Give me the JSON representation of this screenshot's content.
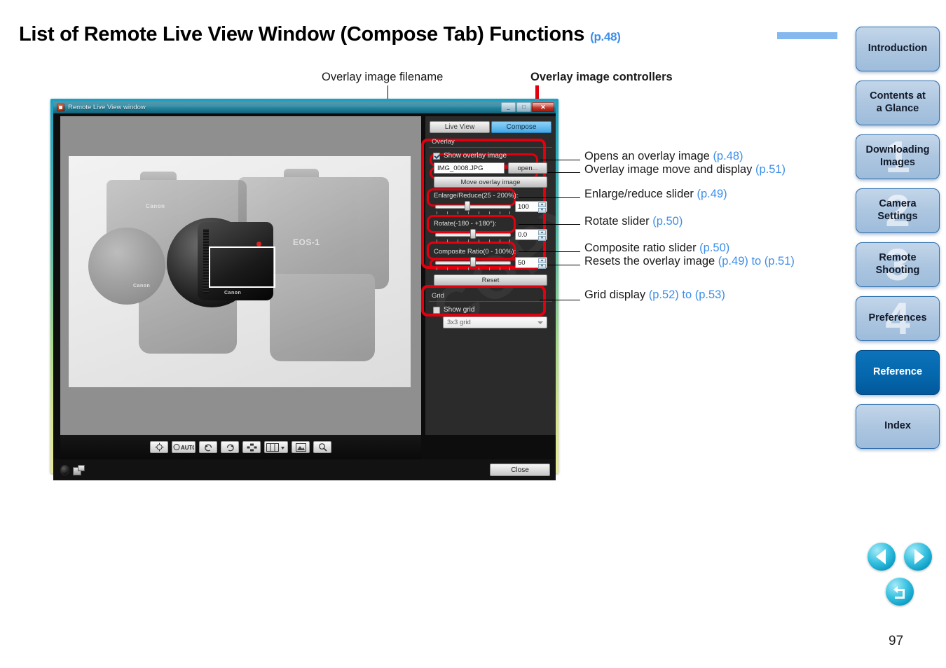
{
  "header": {
    "title": "List of Remote Live View Window (Compose Tab) Functions",
    "title_pageref": "(p.48)"
  },
  "top_captions": {
    "filename": "Overlay image filename",
    "controllers": "Overlay image controllers"
  },
  "window": {
    "title": "Remote Live View window",
    "title_icon": "camera-app-icon",
    "controls": {
      "minimize": "_",
      "maximize": "□",
      "close": "✕"
    },
    "tabs": [
      {
        "label": "Live View",
        "active": false
      },
      {
        "label": "Compose",
        "active": true
      }
    ],
    "watermark": "COPY",
    "overlay_group": {
      "title": "Overlay",
      "show_overlay_label": "Show overlay image",
      "show_overlay_checked": true,
      "filename_value": "IMG_0008.JPG",
      "open_button": "open...",
      "move_button": "Move overlay image",
      "sliders": [
        {
          "label": "Enlarge/Reduce(25 - 200%):",
          "value": "100",
          "thumb_pct": 42
        },
        {
          "label": "Rotate(-180 - +180°):",
          "value": "0.0",
          "thumb_pct": 49
        },
        {
          "label": "Composite Ratio(0 - 100%):",
          "value": "50",
          "thumb_pct": 49
        }
      ],
      "reset_button": "Reset"
    },
    "grid_group": {
      "title": "Grid",
      "show_grid_label": "Show grid",
      "show_grid_checked": false,
      "grid_select_value": "3x3 grid"
    },
    "toolbar_icons": [
      "focus-target-icon",
      "auto-focus-icon",
      "rotate-left-icon",
      "rotate-right-icon",
      "depth-of-field-icon",
      "split-view-icon",
      "image-quality-icon",
      "zoom-magnifier-icon"
    ],
    "statusbar": {
      "indicator_icon": "recording-indicator-icon",
      "transfer_icon": "image-transfer-icon",
      "close_button": "Close"
    }
  },
  "annotations": [
    {
      "text": "Opens an overlay image ",
      "pageref": "(p.48)",
      "suffix": ""
    },
    {
      "text": "Overlay image move and display ",
      "pageref": "(p.51)",
      "suffix": ""
    },
    {
      "text": "Enlarge/reduce slider ",
      "pageref": "(p.49)",
      "suffix": ""
    },
    {
      "text": "Rotate slider ",
      "pageref": "(p.50)",
      "suffix": ""
    },
    {
      "text": "Composite ratio slider ",
      "pageref": "(p.50)",
      "suffix": ""
    },
    {
      "text": "Resets the overlay image ",
      "pageref": "(p.49)",
      "suffix": " to (p.51)"
    },
    {
      "text": "Grid display ",
      "pageref": "(p.52)",
      "suffix": " to (p.53)"
    }
  ],
  "sidebar": {
    "items": [
      {
        "label": "Introduction",
        "number": "",
        "active": false
      },
      {
        "label": "Contents at\na Glance",
        "number": "",
        "active": false
      },
      {
        "label": "Downloading\nImages",
        "number": "1",
        "active": false
      },
      {
        "label": "Camera\nSettings",
        "number": "2",
        "active": false
      },
      {
        "label": "Remote\nShooting",
        "number": "3",
        "active": false
      },
      {
        "label": "Preferences",
        "number": "4",
        "active": false
      },
      {
        "label": "Reference",
        "number": "",
        "active": true
      },
      {
        "label": "Index",
        "number": "",
        "active": false
      }
    ]
  },
  "nav_buttons": {
    "previous": "previous-page-icon",
    "next": "next-page-icon",
    "back": "return-back-icon"
  },
  "page_number": "97",
  "colors": {
    "accent_blue": "#3c8ee8",
    "annotation_red": "#e2000f",
    "active_nav": "#0568ae",
    "title_rule": "#84b8ee"
  }
}
